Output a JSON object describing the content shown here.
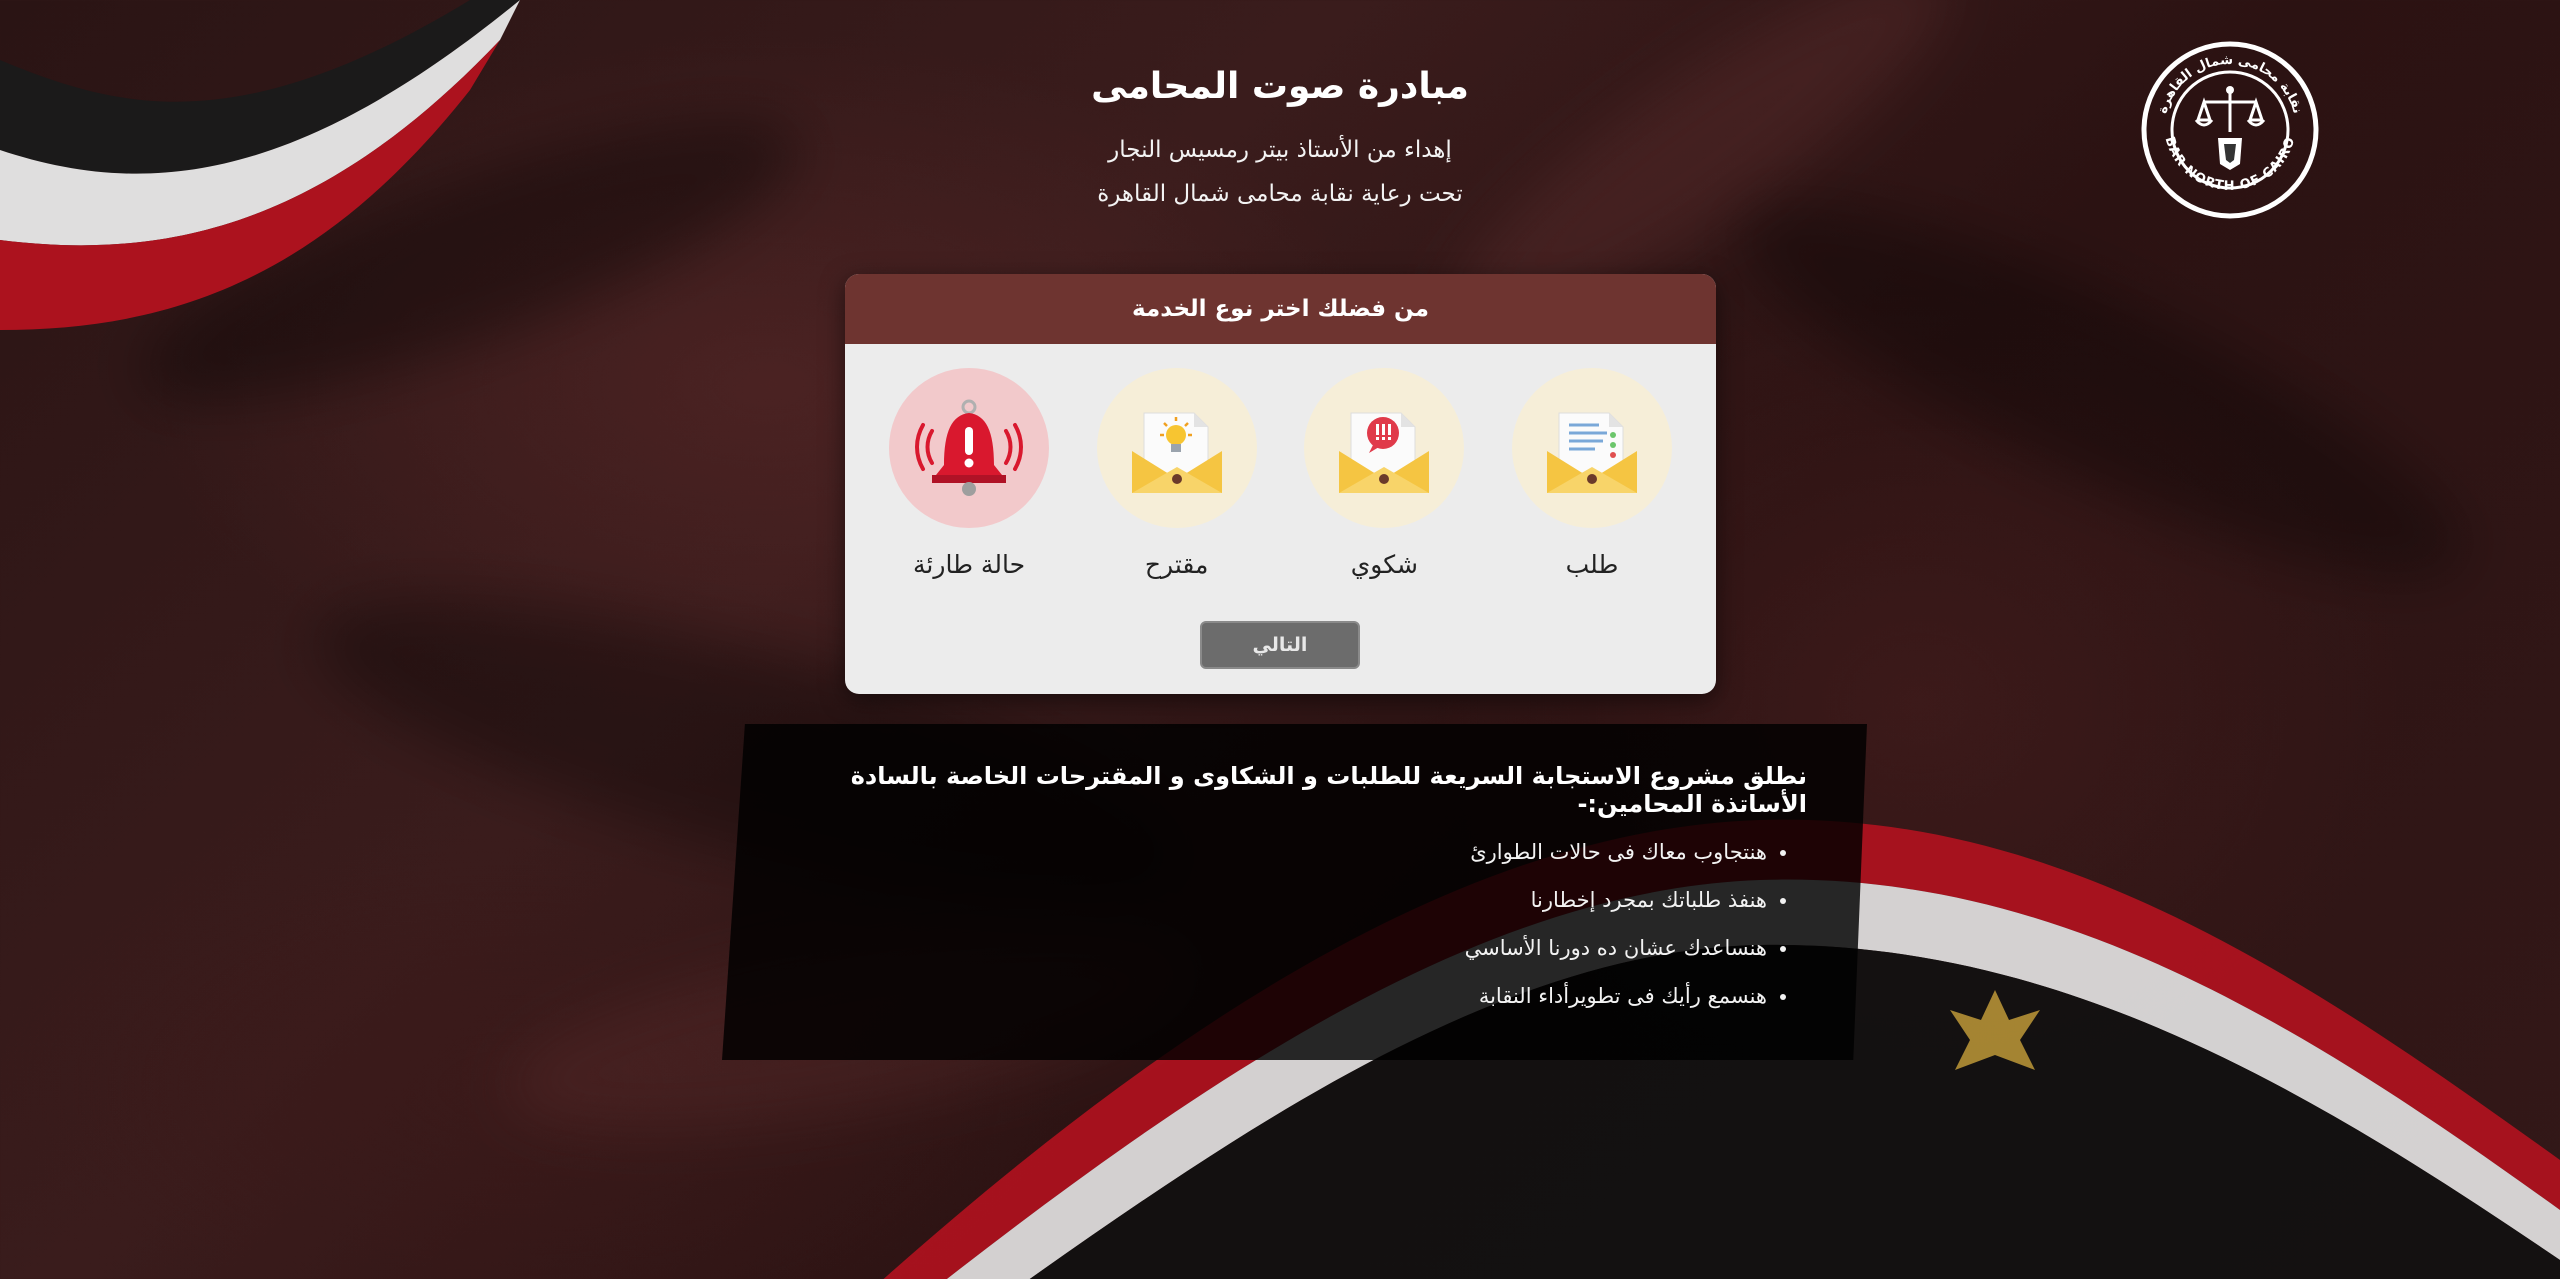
{
  "logo": {
    "arabic_text": "نقابة محامى شمال القاهرة",
    "english_text": "BAR NORTH OF CAIRO"
  },
  "header": {
    "title": "مبادرة صوت المحامى",
    "subtitle": "إهداء من الأستاذ بيتر رمسيس النجار",
    "subtitle2": "تحت رعاية نقابة محامى شمال القاهرة"
  },
  "service_card": {
    "heading": "من فضلك اختر نوع الخدمة",
    "options": [
      {
        "label": "طلب",
        "icon": "request-envelope-icon"
      },
      {
        "label": "شكوي",
        "icon": "complaint-envelope-icon"
      },
      {
        "label": "مقترح",
        "icon": "suggestion-envelope-icon"
      },
      {
        "label": "حالة طارئة",
        "icon": "emergency-bell-icon"
      }
    ],
    "next_label": "التالي"
  },
  "info": {
    "title": "نطلق مشروع الاستجابة السريعة للطلبات و الشكاوى و المقترحات الخاصة بالسادة الأساتذة المحامين:-",
    "bullets": [
      "هنتجاوب معاك فى حالات الطوارئ",
      "هنفذ طلباتك بمجرد إخطارنا",
      "هنساعدك عشان ده دورنا الأساسي",
      "هنسمع رأيك فى تطويرأداء النقابة"
    ]
  },
  "colors": {
    "card_header": "#6e3430",
    "card_body": "#ececec",
    "button": "#6c6c6c",
    "emergency": "#d9182e",
    "envelope": "#f5c542"
  }
}
